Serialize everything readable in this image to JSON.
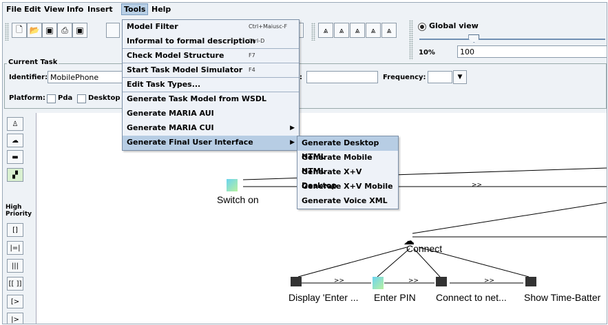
{
  "menubar": {
    "items": [
      "File",
      "Edit",
      "View",
      "Info",
      "Insert",
      "Tools",
      "Help"
    ]
  },
  "tools_menu": {
    "items": [
      {
        "label": "Model Filter",
        "shortcut": "Ctrl+Maiusc-F"
      },
      {
        "label": "Informal to formal description",
        "shortcut": "Ctrl-D"
      },
      {
        "label": "Check Model Structure",
        "shortcut": "F7"
      },
      {
        "label": "Start Task Model Simulator",
        "shortcut": "F4"
      },
      {
        "label": "Edit Task Types...",
        "shortcut": ""
      },
      {
        "label": "Generate Task Model from WSDL",
        "shortcut": ""
      },
      {
        "label": "Generate MARIA AUI",
        "shortcut": ""
      },
      {
        "label": "Generate MARIA CUI",
        "shortcut": ""
      },
      {
        "label": "Generate Final User Interface",
        "shortcut": ""
      }
    ]
  },
  "submenu": {
    "items": [
      "Generate Desktop HTML",
      "Generate Mobile HTML",
      "Generate X+V Desktop",
      "Generate X+V Mobile",
      "Generate Voice XML"
    ]
  },
  "view": {
    "global_view_label": "Global view",
    "zoom_percent": "10%",
    "zoom_value": "100",
    "slider_level": 0.29
  },
  "current_task": {
    "title": "Current Task",
    "identifier_label": "Identifier:",
    "identifier_value": "MobilePhone",
    "colon_label": ":",
    "frequency_label": "Frequency:",
    "platform_label": "Platform:",
    "platform_pda": "Pda",
    "platform_desktop": "Desktop"
  },
  "palette": {
    "priority_label": "High Priority",
    "operators": [
      "[]",
      "|=|",
      "|||",
      "[[ ]]",
      "[>",
      "|>"
    ]
  },
  "diagram": {
    "operator_symbol": ">>",
    "nodes": {
      "switch_on": "Switch on",
      "connect": "Connect",
      "display_enter": "Display 'Enter ...",
      "enter_pin": "Enter PIN",
      "connect_to_net": "Connect to net...",
      "show_time": "Show Time-Batter"
    }
  },
  "colors": {
    "menu_highlight": "#b7cde4",
    "chrome": "#eef2f6"
  }
}
